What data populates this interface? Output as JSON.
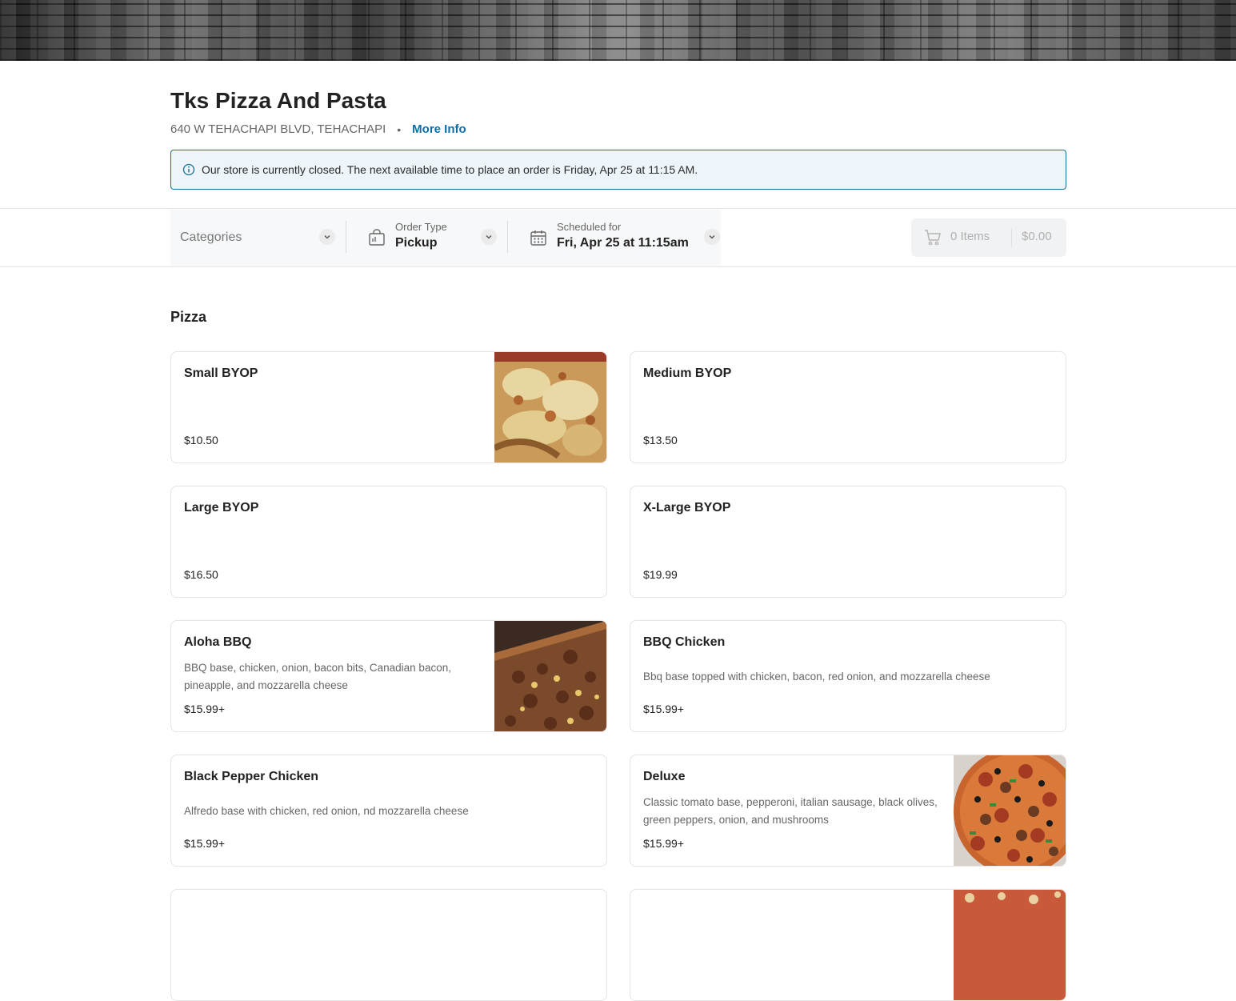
{
  "store": {
    "name": "Tks Pizza And Pasta",
    "address": "640 W TEHACHAPI BLVD, TEHACHAPI",
    "separator": "•",
    "more_info": "More Info"
  },
  "alert": {
    "message": "Our store is currently closed. The next available time to place an order is Friday, Apr 25 at 11:15 AM."
  },
  "toolbar": {
    "categories_placeholder": "Categories",
    "order_type_label": "Order Type",
    "order_type_value": "Pickup",
    "scheduled_label": "Scheduled for",
    "scheduled_value": "Fri, Apr 25 at 11:15am"
  },
  "cart": {
    "items": "0 Items",
    "total": "$0.00"
  },
  "menu": {
    "section_title": "Pizza",
    "items": [
      {
        "name": "Small BYOP",
        "desc": "",
        "price": "$10.50",
        "image": "pizza-photo"
      },
      {
        "name": "Medium BYOP",
        "desc": "",
        "price": "$13.50"
      },
      {
        "name": "Large BYOP",
        "desc": "",
        "price": "$16.50"
      },
      {
        "name": "X-Large BYOP",
        "desc": "",
        "price": "$19.99"
      },
      {
        "name": "Aloha BBQ",
        "desc": "BBQ base, chicken, onion, bacon bits, Canadian bacon, pineapple, and mozzarella cheese",
        "price": "$15.99+",
        "image": "pizza-photo"
      },
      {
        "name": "BBQ Chicken",
        "desc": "Bbq base topped with chicken, bacon, red onion, and mozzarella cheese",
        "price": "$15.99+"
      },
      {
        "name": "Black Pepper Chicken",
        "desc": "Alfredo base with chicken, red onion, nd mozzarella cheese",
        "price": "$15.99+"
      },
      {
        "name": "Deluxe",
        "desc": "Classic tomato base, pepperoni, italian sausage, black olives, green peppers, onion, and mushrooms",
        "price": "$15.99+",
        "image": "pizza-photo"
      }
    ]
  },
  "colors": {
    "accent": "#0a6fa8",
    "alert_border": "#1b6f93",
    "alert_bg": "#eef5fa"
  }
}
